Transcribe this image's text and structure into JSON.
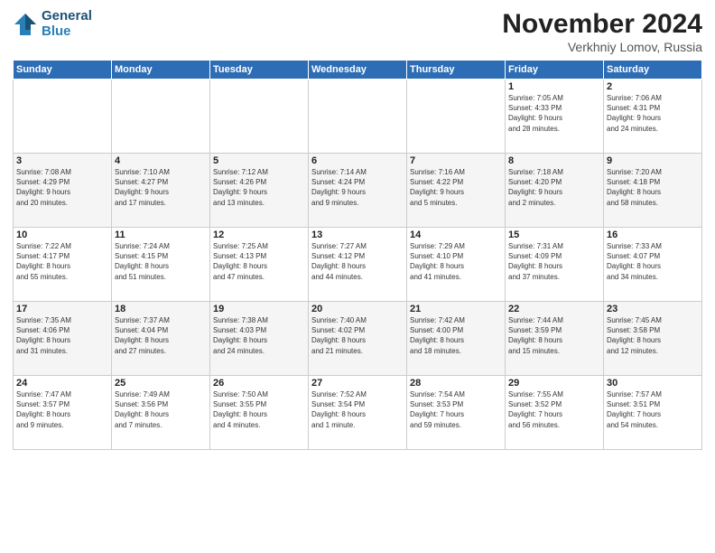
{
  "header": {
    "logo_line1": "General",
    "logo_line2": "Blue",
    "month": "November 2024",
    "location": "Verkhniy Lomov, Russia"
  },
  "weekdays": [
    "Sunday",
    "Monday",
    "Tuesday",
    "Wednesday",
    "Thursday",
    "Friday",
    "Saturday"
  ],
  "weeks": [
    [
      {
        "day": "",
        "info": ""
      },
      {
        "day": "",
        "info": ""
      },
      {
        "day": "",
        "info": ""
      },
      {
        "day": "",
        "info": ""
      },
      {
        "day": "",
        "info": ""
      },
      {
        "day": "1",
        "info": "Sunrise: 7:05 AM\nSunset: 4:33 PM\nDaylight: 9 hours\nand 28 minutes."
      },
      {
        "day": "2",
        "info": "Sunrise: 7:06 AM\nSunset: 4:31 PM\nDaylight: 9 hours\nand 24 minutes."
      }
    ],
    [
      {
        "day": "3",
        "info": "Sunrise: 7:08 AM\nSunset: 4:29 PM\nDaylight: 9 hours\nand 20 minutes."
      },
      {
        "day": "4",
        "info": "Sunrise: 7:10 AM\nSunset: 4:27 PM\nDaylight: 9 hours\nand 17 minutes."
      },
      {
        "day": "5",
        "info": "Sunrise: 7:12 AM\nSunset: 4:26 PM\nDaylight: 9 hours\nand 13 minutes."
      },
      {
        "day": "6",
        "info": "Sunrise: 7:14 AM\nSunset: 4:24 PM\nDaylight: 9 hours\nand 9 minutes."
      },
      {
        "day": "7",
        "info": "Sunrise: 7:16 AM\nSunset: 4:22 PM\nDaylight: 9 hours\nand 5 minutes."
      },
      {
        "day": "8",
        "info": "Sunrise: 7:18 AM\nSunset: 4:20 PM\nDaylight: 9 hours\nand 2 minutes."
      },
      {
        "day": "9",
        "info": "Sunrise: 7:20 AM\nSunset: 4:18 PM\nDaylight: 8 hours\nand 58 minutes."
      }
    ],
    [
      {
        "day": "10",
        "info": "Sunrise: 7:22 AM\nSunset: 4:17 PM\nDaylight: 8 hours\nand 55 minutes."
      },
      {
        "day": "11",
        "info": "Sunrise: 7:24 AM\nSunset: 4:15 PM\nDaylight: 8 hours\nand 51 minutes."
      },
      {
        "day": "12",
        "info": "Sunrise: 7:25 AM\nSunset: 4:13 PM\nDaylight: 8 hours\nand 47 minutes."
      },
      {
        "day": "13",
        "info": "Sunrise: 7:27 AM\nSunset: 4:12 PM\nDaylight: 8 hours\nand 44 minutes."
      },
      {
        "day": "14",
        "info": "Sunrise: 7:29 AM\nSunset: 4:10 PM\nDaylight: 8 hours\nand 41 minutes."
      },
      {
        "day": "15",
        "info": "Sunrise: 7:31 AM\nSunset: 4:09 PM\nDaylight: 8 hours\nand 37 minutes."
      },
      {
        "day": "16",
        "info": "Sunrise: 7:33 AM\nSunset: 4:07 PM\nDaylight: 8 hours\nand 34 minutes."
      }
    ],
    [
      {
        "day": "17",
        "info": "Sunrise: 7:35 AM\nSunset: 4:06 PM\nDaylight: 8 hours\nand 31 minutes."
      },
      {
        "day": "18",
        "info": "Sunrise: 7:37 AM\nSunset: 4:04 PM\nDaylight: 8 hours\nand 27 minutes."
      },
      {
        "day": "19",
        "info": "Sunrise: 7:38 AM\nSunset: 4:03 PM\nDaylight: 8 hours\nand 24 minutes."
      },
      {
        "day": "20",
        "info": "Sunrise: 7:40 AM\nSunset: 4:02 PM\nDaylight: 8 hours\nand 21 minutes."
      },
      {
        "day": "21",
        "info": "Sunrise: 7:42 AM\nSunset: 4:00 PM\nDaylight: 8 hours\nand 18 minutes."
      },
      {
        "day": "22",
        "info": "Sunrise: 7:44 AM\nSunset: 3:59 PM\nDaylight: 8 hours\nand 15 minutes."
      },
      {
        "day": "23",
        "info": "Sunrise: 7:45 AM\nSunset: 3:58 PM\nDaylight: 8 hours\nand 12 minutes."
      }
    ],
    [
      {
        "day": "24",
        "info": "Sunrise: 7:47 AM\nSunset: 3:57 PM\nDaylight: 8 hours\nand 9 minutes."
      },
      {
        "day": "25",
        "info": "Sunrise: 7:49 AM\nSunset: 3:56 PM\nDaylight: 8 hours\nand 7 minutes."
      },
      {
        "day": "26",
        "info": "Sunrise: 7:50 AM\nSunset: 3:55 PM\nDaylight: 8 hours\nand 4 minutes."
      },
      {
        "day": "27",
        "info": "Sunrise: 7:52 AM\nSunset: 3:54 PM\nDaylight: 8 hours\nand 1 minute."
      },
      {
        "day": "28",
        "info": "Sunrise: 7:54 AM\nSunset: 3:53 PM\nDaylight: 7 hours\nand 59 minutes."
      },
      {
        "day": "29",
        "info": "Sunrise: 7:55 AM\nSunset: 3:52 PM\nDaylight: 7 hours\nand 56 minutes."
      },
      {
        "day": "30",
        "info": "Sunrise: 7:57 AM\nSunset: 3:51 PM\nDaylight: 7 hours\nand 54 minutes."
      }
    ]
  ]
}
